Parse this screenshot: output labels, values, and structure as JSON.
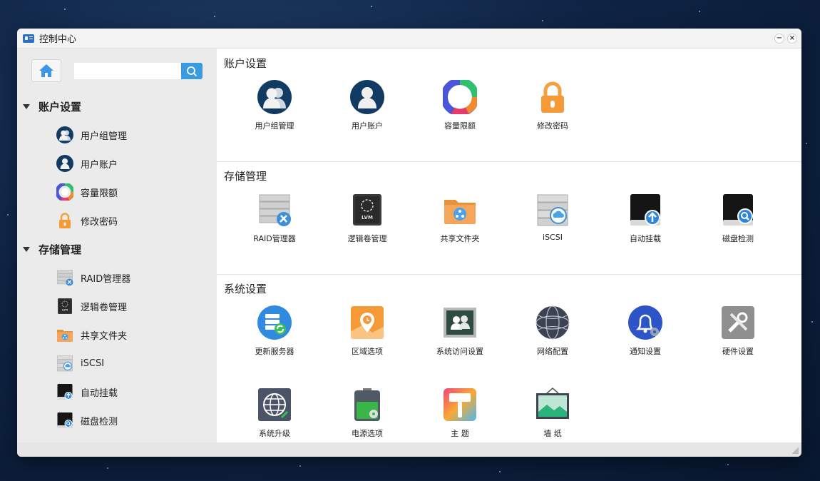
{
  "window": {
    "title": "控制中心"
  },
  "sidebar": {
    "search": {
      "value": "",
      "placeholder": ""
    },
    "sections": [
      {
        "label": "账户设置",
        "items": [
          {
            "label": "用户组管理",
            "icon": "user-group-icon"
          },
          {
            "label": "用户账户",
            "icon": "user-account-icon"
          },
          {
            "label": "容量限额",
            "icon": "quota-icon"
          },
          {
            "label": "修改密码",
            "icon": "lock-icon"
          }
        ]
      },
      {
        "label": "存储管理",
        "items": [
          {
            "label": "RAID管理器",
            "icon": "raid-icon"
          },
          {
            "label": "逻辑卷管理",
            "icon": "lvm-icon"
          },
          {
            "label": "共享文件夹",
            "icon": "shared-folder-icon"
          },
          {
            "label": "iSCSI",
            "icon": "iscsi-icon"
          },
          {
            "label": "自动挂载",
            "icon": "automount-icon"
          },
          {
            "label": "磁盘检测",
            "icon": "disk-check-icon"
          }
        ]
      }
    ]
  },
  "main": {
    "sections": [
      {
        "title": "账户设置",
        "tiles": [
          {
            "label": "用户组管理",
            "icon": "user-group-icon"
          },
          {
            "label": "用户账户",
            "icon": "user-account-icon"
          },
          {
            "label": "容量限额",
            "icon": "quota-icon"
          },
          {
            "label": "修改密码",
            "icon": "lock-icon"
          }
        ]
      },
      {
        "title": "存储管理",
        "tiles": [
          {
            "label": "RAID管理器",
            "icon": "raid-icon"
          },
          {
            "label": "逻辑卷管理",
            "icon": "lvm-icon"
          },
          {
            "label": "共享文件夹",
            "icon": "shared-folder-icon"
          },
          {
            "label": "iSCSI",
            "icon": "iscsi-icon"
          },
          {
            "label": "自动挂载",
            "icon": "automount-icon"
          },
          {
            "label": "磁盘检测",
            "icon": "disk-check-icon"
          }
        ]
      },
      {
        "title": "系统设置",
        "tiles": [
          {
            "label": "更新服务器",
            "icon": "update-server-icon"
          },
          {
            "label": "区域选项",
            "icon": "region-icon"
          },
          {
            "label": "系统访问设置",
            "icon": "access-icon"
          },
          {
            "label": "网络配置",
            "icon": "network-icon"
          },
          {
            "label": "通知设置",
            "icon": "bell-icon"
          },
          {
            "label": "硬件设置",
            "icon": "hardware-icon"
          },
          {
            "label": "系统升级",
            "icon": "upgrade-icon"
          },
          {
            "label": "电源选项",
            "icon": "power-icon"
          },
          {
            "label": "主 题",
            "icon": "theme-icon"
          },
          {
            "label": "墙 纸",
            "icon": "wallpaper-icon"
          }
        ]
      }
    ]
  },
  "lvm_text": "LVM"
}
